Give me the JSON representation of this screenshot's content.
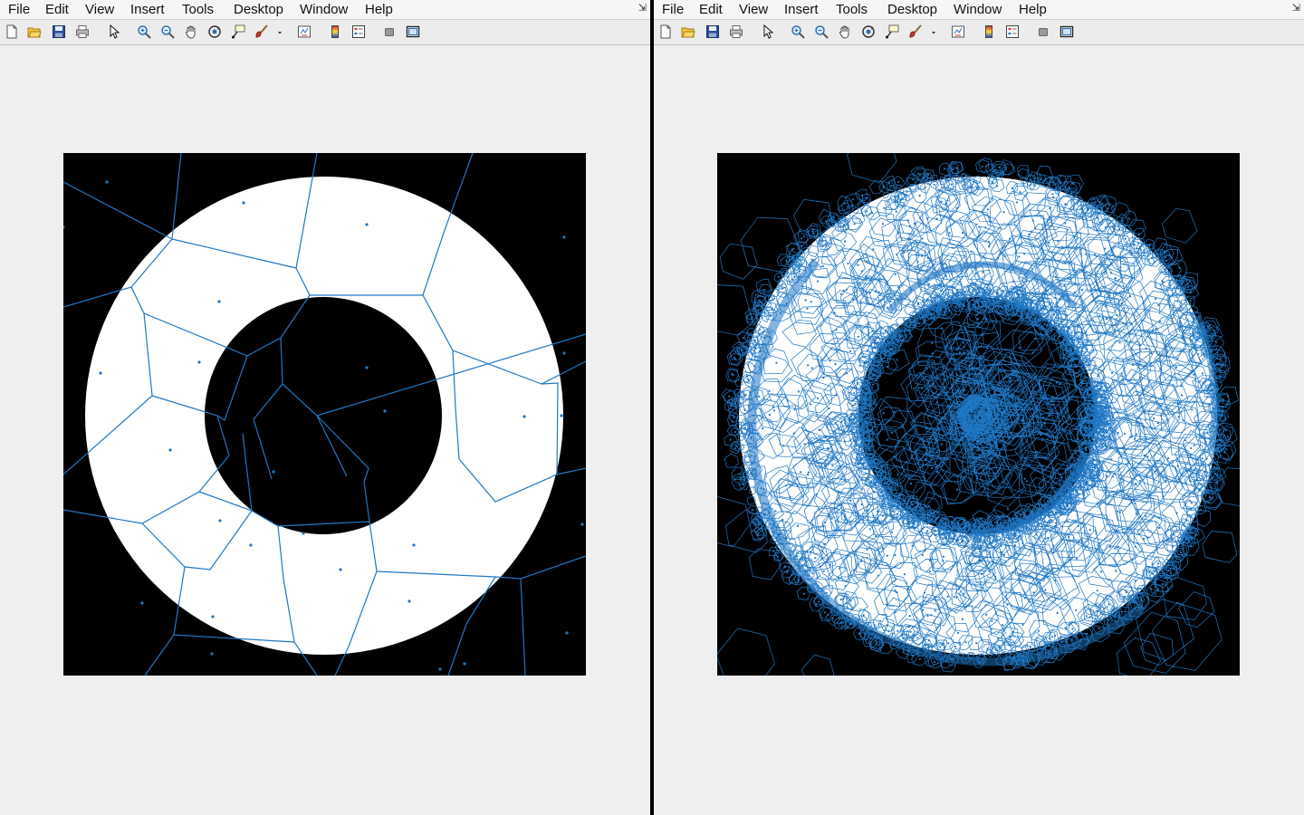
{
  "menu": [
    "File",
    "Edit",
    "View",
    "Insert",
    "Tools",
    "Desktop",
    "Window",
    "Help"
  ],
  "dock_glyph": "⇲",
  "toolbar": [
    "new-figure",
    "open-file",
    "save",
    "print",
    "edit-plot-pointer",
    "zoom-in",
    "zoom-out",
    "pan",
    "rotate-3d",
    "data-cursor",
    "brush",
    "brush-menu",
    "link-plot",
    "insert-colorbar",
    "insert-legend",
    "hide-plot-tools",
    "show-plot-tools"
  ],
  "colors": {
    "diagram_edges": "#1f77c4",
    "sites": "#1f77c4",
    "image_foreground": "#ffffff",
    "image_background": "#000000"
  },
  "figures": [
    {
      "id": "left",
      "content": "Voronoi diagram of sparse sites over a binary ring image"
    },
    {
      "id": "right",
      "content": "Voronoi diagram of dense sites concentrated at the ring edges"
    }
  ]
}
